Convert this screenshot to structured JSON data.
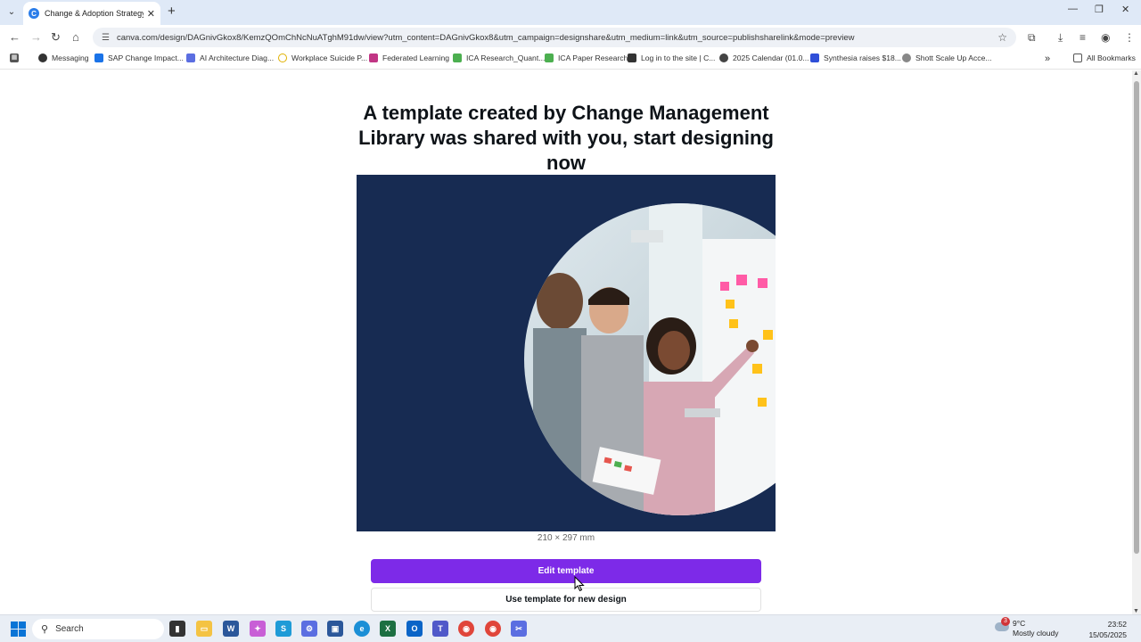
{
  "browser": {
    "tab_title": "Change & Adoption Strategy G",
    "url": "canva.com/design/DAGnivGkox8/KemzQOmChNcNuATghM91dw/view?utm_content=DAGnivGkox8&utm_campaign=designshare&utm_medium=link&utm_source=publishsharelink&mode=preview",
    "bookmarks": [
      "Messaging",
      "SAP Change Impact...",
      "AI Architecture Diag...",
      "Workplace Suicide P...",
      "Federated Learning",
      "ICA Research_Quant...",
      "ICA Paper Research",
      "Log in to the site | C...",
      "2025 Calendar (01.0...",
      "Synthesia raises $18...",
      "Shott Scale Up Acce..."
    ],
    "all_bookmarks": "All Bookmarks"
  },
  "page": {
    "heading": "A template created by Change Management Library was shared with you, start designing now",
    "dimensions": "210 × 297 mm",
    "edit_button": "Edit template",
    "use_button": "Use template for new design"
  },
  "taskbar": {
    "search_placeholder": "Search",
    "weather_badge": "3",
    "temperature": "9°C",
    "condition": "Mostly cloudy",
    "time": "23:52",
    "date": "15/05/2025"
  },
  "colors": {
    "canva_purple": "#7d2ae8",
    "preview_navy": "#172b52"
  }
}
